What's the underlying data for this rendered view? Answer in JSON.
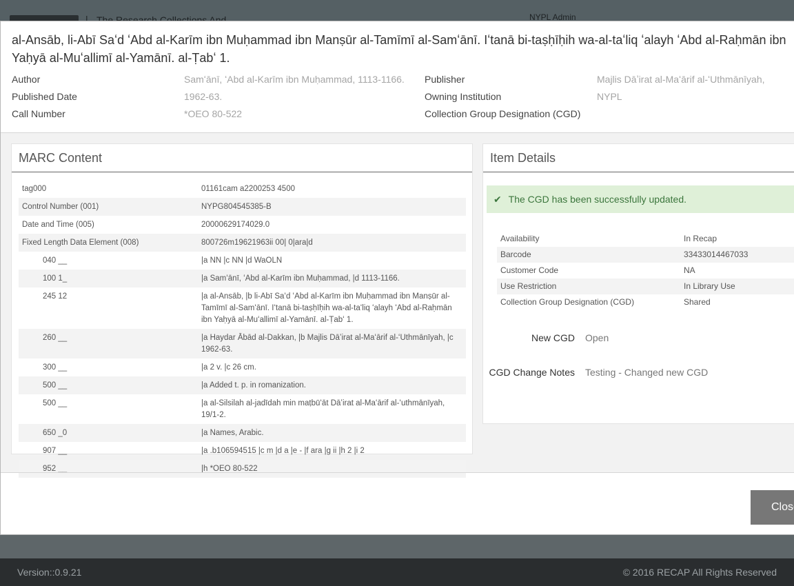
{
  "background": {
    "tagline": "The Research Collections And",
    "user_label": "NYPL Admin"
  },
  "modal": {
    "title": "al-Ansāb, li-Abī Saʻd ʻAbd al-Karīm ibn Muḥammad ibn Manṣūr al-Tamīmī al-Samʻānī. Iʻtanā bi-taṣḥīḥih wa-al-taʻliq ʻalayh ʻAbd al-Raḥmān ibn Yaḥyā al-Muʻallimī al-Yamānī. al-Ṭabʻ 1.",
    "meta": {
      "author_label": "Author",
      "author_value": "Samʻānī, ʻAbd al-Karīm ibn Muḥammad, 1113-1166.",
      "published_date_label": "Published Date",
      "published_date_value": "1962-63.",
      "call_number_label": "Call Number",
      "call_number_value": "*OEO 80-522",
      "publisher_label": "Publisher",
      "publisher_value": "Majlis Dāʼirat al-Maʻārif al-ʻUthmānīyah,",
      "owning_institution_label": "Owning Institution",
      "owning_institution_value": "NYPL",
      "cgd_label": "Collection Group Designation (CGD)",
      "cgd_value": ""
    },
    "marc": {
      "heading": "MARC Content",
      "rows": [
        {
          "tag": "tag000",
          "content": "01161cam a2200253 4500",
          "indent": false
        },
        {
          "tag": "Control Number (001)",
          "content": "NYPG804545385-B",
          "indent": false
        },
        {
          "tag": "Date and Time (005)",
          "content": "20000629174029.0",
          "indent": false
        },
        {
          "tag": "Fixed Length Data Element (008)",
          "content": "800726m19621963ii 00| 0|ara|d",
          "indent": false
        },
        {
          "tag": "040 __",
          "content": "|a NN |c NN |d WaOLN",
          "indent": true
        },
        {
          "tag": "100 1_",
          "content": "|a Samʻānī, ʻAbd al-Karīm ibn Muḥammad, |d 1113-1166.",
          "indent": true
        },
        {
          "tag": "245 12",
          "content": "|a al-Ansāb, |b li-Abī Saʻd ʻAbd al-Karīm ibn Muḥammad ibn Manṣūr al-Tamīmī al-Samʻānī. Iʻtanā bi-taṣḥīḥih wa-al-taʻliq ʻalayh ʻAbd al-Raḥmān ibn Yaḥyā al-Muʻallimī al-Yamānī. al-Ṭabʻ 1.",
          "indent": true
        },
        {
          "tag": "260 __",
          "content": "|a Haydar Ābād al-Dakkan, |b Majlis Dāʼirat al-Maʻārif al-ʻUthmānīyah, |c 1962-63.",
          "indent": true
        },
        {
          "tag": "300 __",
          "content": "|a 2 v. |c 26 cm.",
          "indent": true
        },
        {
          "tag": "500 __",
          "content": "|a Added t. p. in romanization.",
          "indent": true
        },
        {
          "tag": "500 __",
          "content": "|a al-Silsilah al-jadīdah min maṭbūʻāt Dāʼirat al-Maʻārif al-ʻuthmānīyah, 19/1-2.",
          "indent": true
        },
        {
          "tag": "650 _0",
          "content": "|a Names, Arabic.",
          "indent": true
        },
        {
          "tag": "907 __",
          "content": "|a .b106594515 |c m |d a |e - |f ara |g ii |h 2 |i 2",
          "indent": true
        },
        {
          "tag": "952 __",
          "content": "|h *OEO 80-522",
          "indent": true
        }
      ]
    },
    "item": {
      "heading": "Item Details",
      "alert_icon": "✔",
      "alert_text": "The CGD has been successfully updated.",
      "details": [
        {
          "label": "Availability",
          "value": "In Recap"
        },
        {
          "label": "Barcode",
          "value": "33433014467033"
        },
        {
          "label": "Customer Code",
          "value": "NA"
        },
        {
          "label": "Use Restriction",
          "value": "In Library Use"
        },
        {
          "label": "Collection Group Designation (CGD)",
          "value": "Shared"
        }
      ],
      "new_cgd_label": "New CGD",
      "new_cgd_value": "Open",
      "cgd_notes_label": "CGD Change Notes",
      "cgd_notes_value": "Testing - Changed new CGD"
    },
    "close_label": "Close"
  },
  "footer": {
    "version": "Version::0.9.21",
    "copyright": "© 2016 RECAP All Rights Reserved"
  }
}
